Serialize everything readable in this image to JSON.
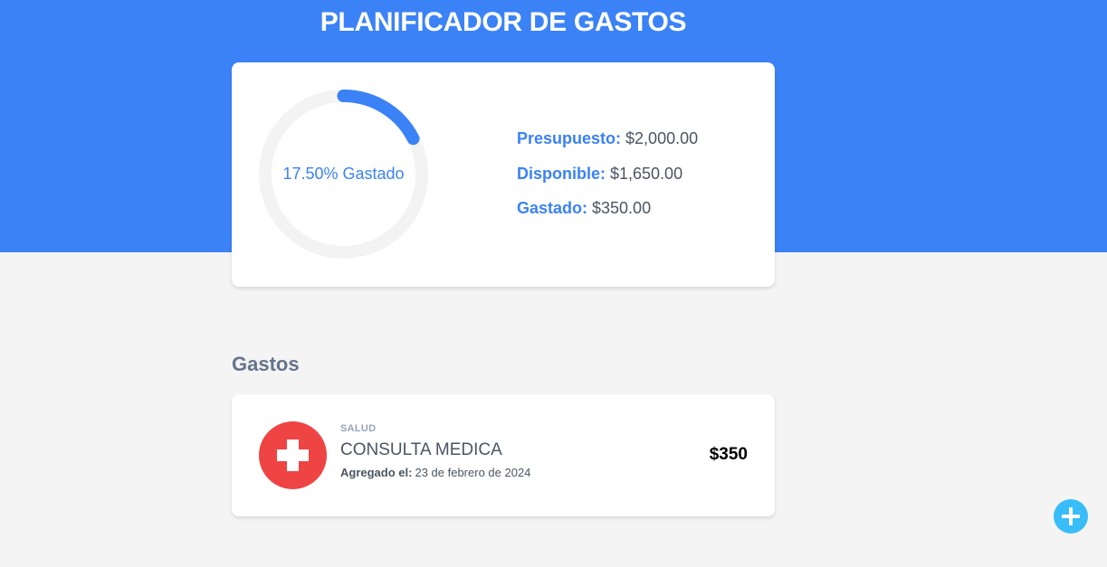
{
  "header": {
    "title": "PLANIFICADOR DE GASTOS"
  },
  "budget": {
    "progress_text": "17.50% Gastado",
    "progress_fraction": 0.175,
    "presupuesto_label": "Presupuesto:",
    "presupuesto_value": "$2,000.00",
    "disponible_label": "Disponible:",
    "disponible_value": "$1,650.00",
    "gastado_label": "Gastado:",
    "gastado_value": "$350.00"
  },
  "expenses": {
    "heading": "Gastos",
    "items": [
      {
        "category": "SALUD",
        "name": "CONSULTA MEDICA",
        "date_label": "Agregado el:",
        "date_value": "23 de febrero de 2024",
        "amount": "$350",
        "icon": "medical-cross-icon"
      }
    ]
  },
  "actions": {
    "add_icon": "plus-icon"
  },
  "colors": {
    "primary": "#3b82f6",
    "background": "#f4f4f4",
    "health_category": "#ef4444",
    "add_button": "#38bdf8"
  }
}
